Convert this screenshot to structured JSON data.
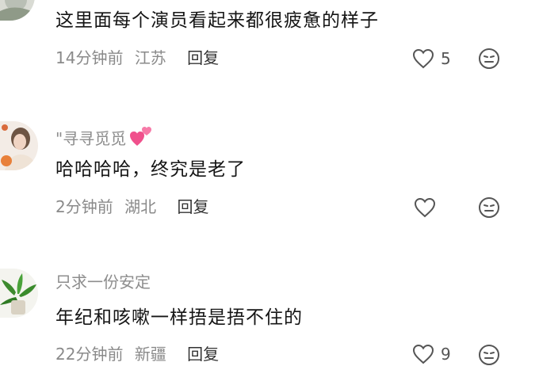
{
  "comments": [
    {
      "username": "",
      "text": "这里面每个演员看起来都很疲惫的样子",
      "time": "14分钟前",
      "location": "江苏",
      "reply_label": "回复",
      "likes": "5"
    },
    {
      "username": "\"寻寻觅觅",
      "text": "哈哈哈哈，终究是老了",
      "time": "2分钟前",
      "location": "湖北",
      "reply_label": "回复",
      "likes": ""
    },
    {
      "username": "只求一份安定",
      "text": "年纪和咳嗽一样捂是捂不住的",
      "time": "22分钟前",
      "location": "新疆",
      "reply_label": "回复",
      "likes": "9"
    }
  ],
  "icons": {
    "like": "heart-outline-icon",
    "react": "smiley-face-icon",
    "badge": "two-hearts-emoji"
  },
  "colors": {
    "text": "#151515",
    "meta": "#8a8a8a",
    "username": "#8d8d8d",
    "icon": "#555555",
    "heart_emoji": "#f0508c"
  }
}
